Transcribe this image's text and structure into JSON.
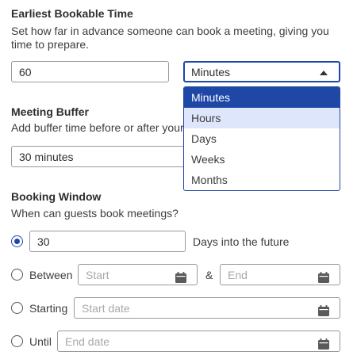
{
  "earliest": {
    "heading": "Earliest Bookable Time",
    "desc_line1": "Set how far in advance someone can book a meeting, giving you",
    "desc_line2": "time to prepare.",
    "value": "60",
    "unit_selected": "Minutes",
    "unit_options": [
      "Minutes",
      "Hours",
      "Days",
      "Weeks",
      "Months"
    ]
  },
  "buffer": {
    "heading": "Meeting Buffer",
    "desc": "Add buffer time before or after your",
    "value": "30 minutes"
  },
  "window": {
    "heading": "Booking Window",
    "desc": "When can guests book meetings?",
    "days_value": "30",
    "days_suffix": "Days into the future",
    "between_label": "Between",
    "start_placeholder": "Start",
    "amp": "&",
    "end_placeholder": "End",
    "starting_label": "Starting",
    "start_date_placeholder": "Start date",
    "until_label": "Until",
    "end_date_placeholder": "End date"
  },
  "colors": {
    "accent": "#1f47a6",
    "hover": "#dde6fa"
  }
}
